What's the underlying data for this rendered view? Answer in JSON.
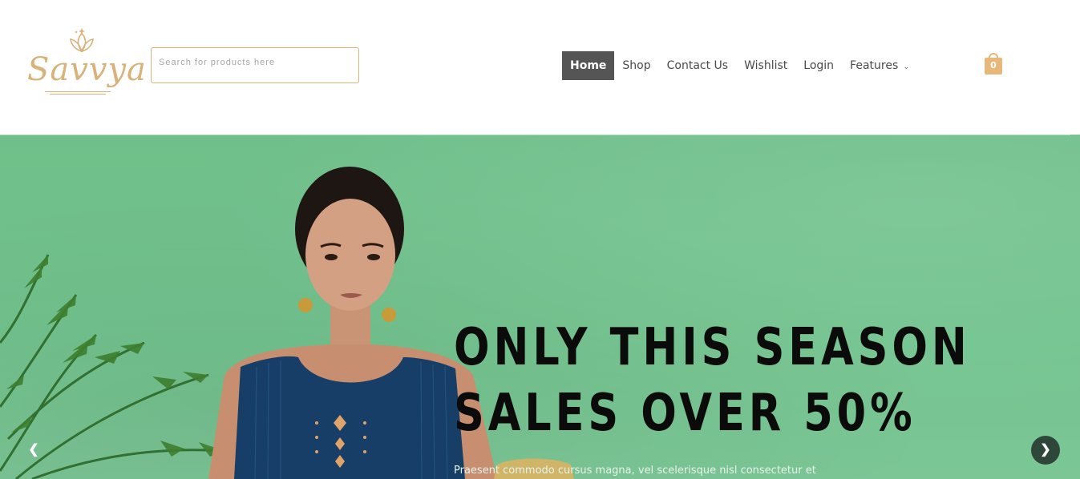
{
  "brand": {
    "name": "Savvya",
    "logo_icon": "lotus-icon",
    "color": "#d9b17a"
  },
  "search": {
    "placeholder": "Search for products here"
  },
  "nav": {
    "items": [
      {
        "label": "Home",
        "active": true
      },
      {
        "label": "Shop"
      },
      {
        "label": "Contact Us"
      },
      {
        "label": "Wishlist"
      },
      {
        "label": "Login"
      },
      {
        "label": "Features",
        "icon": "chevron-down-icon"
      }
    ]
  },
  "cart": {
    "count": "0",
    "icon": "shopping-bag-icon",
    "color": "#e8b77a"
  },
  "hero": {
    "headline_line1": "ONLY THIS SEASON",
    "headline_line2": "SALES OVER 50%",
    "subtext": "Praesent commodo cursus magna, vel scelerisque nisl consectetur et",
    "background_color": "#72c28d",
    "prev_icon": "chevron-left-icon",
    "next_icon": "chevron-right-icon"
  },
  "colors": {
    "nav_active_bg": "#555555",
    "accent": "#d9b17a"
  }
}
